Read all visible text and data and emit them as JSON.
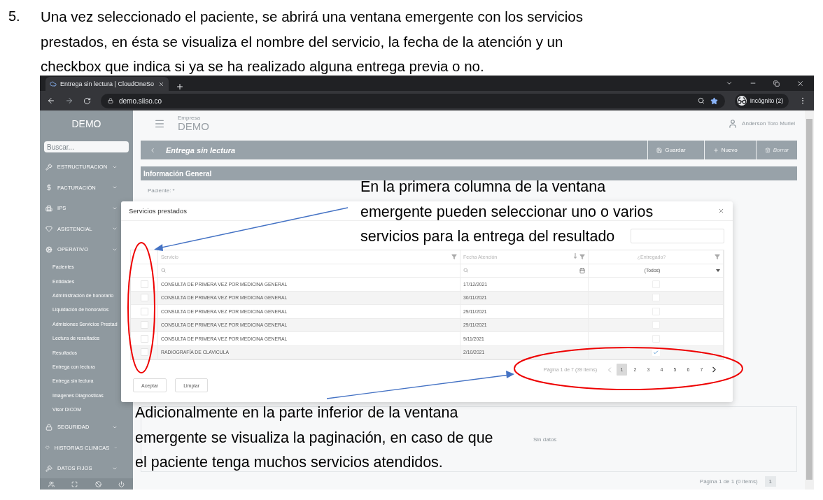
{
  "instruction": {
    "number": "5.",
    "text": "Una vez seleccionado el paciente, se abrirá una ventana emergente con los servicios\nprestados, en ésta se visualiza el nombre del servicio, la fecha de la atención y un\ncheckbox que indica si ya se ha realizado alguna entrega previa o no."
  },
  "browser": {
    "tab_title": "Entrega sin lectura | CloudOneSo",
    "url": "demo.siiso.co",
    "profile": "Incógnito (2)"
  },
  "sidebar": {
    "logo": "DEMO",
    "search_placeholder": "Buscar...",
    "sections": [
      {
        "label": "ESTRUCTURACION"
      },
      {
        "label": "FACTURACIÓN"
      },
      {
        "label": "IPS"
      },
      {
        "label": "ASISTENCIAL"
      },
      {
        "label": "OPERATIVO",
        "children": [
          {
            "label": "Pacientes"
          },
          {
            "label": "Entidades"
          },
          {
            "label": "Administración de honorario"
          },
          {
            "label": "Liquidación de honorarios"
          },
          {
            "label": "Admisiones Servicios Prestad"
          },
          {
            "label": "Lectura de resultados"
          },
          {
            "label": "Resultados"
          },
          {
            "label": "Entrega con lectura"
          },
          {
            "label": "Entrega sin lectura"
          },
          {
            "label": "Imagenes Diagnosticas"
          },
          {
            "label": "Visor DICOM"
          }
        ]
      },
      {
        "label": "SEGURIDAD"
      },
      {
        "label": "HISTORIAS CLINICAS"
      },
      {
        "label": "DATOS FIJOS"
      }
    ]
  },
  "header": {
    "company_label": "Empresa",
    "company": "DEMO",
    "user": "Anderson Toro Muriel"
  },
  "page_title": "Entrega sin lectura",
  "actions": [
    {
      "label": "Guardar",
      "disabled": false
    },
    {
      "label": "Nuevo",
      "disabled": false
    },
    {
      "label": "Borrar",
      "disabled": true
    }
  ],
  "section_title": "Información General",
  "field_label": "Paciente: *",
  "lower_grid": {
    "empty_text": "Sin datos",
    "pager": "Página 1 de 1 (0 items)",
    "page": "1"
  },
  "dialog": {
    "title": "Servicios prestados",
    "columns": [
      "Servicio",
      "Fecha Atención",
      "¿Entregado?"
    ],
    "filter_value": "(Todos)",
    "rows": [
      {
        "selected": false,
        "service": "CONSULTA DE PRIMERA VEZ POR MEDICINA GENERAL",
        "date": "17/12/2021",
        "delivered": false
      },
      {
        "selected": false,
        "service": "CONSULTA DE PRIMERA VEZ POR MEDICINA GENERAL",
        "date": "30/11/2021",
        "delivered": false
      },
      {
        "selected": false,
        "service": "CONSULTA DE PRIMERA VEZ POR MEDICINA GENERAL",
        "date": "29/11/2021",
        "delivered": false
      },
      {
        "selected": false,
        "service": "CONSULTA DE PRIMERA VEZ POR MEDICINA GENERAL",
        "date": "29/11/2021",
        "delivered": false
      },
      {
        "selected": false,
        "service": "CONSULTA DE PRIMERA VEZ POR MEDICINA GENERAL",
        "date": "9/11/2021",
        "delivered": false
      },
      {
        "selected": false,
        "service": "RADIOGRAFÍA DE CLAVICULA",
        "date": "2/10/2021",
        "delivered": true
      }
    ],
    "pager": {
      "summary": "Página 1 de 7 (39 items)",
      "pages": [
        {
          "label": "1",
          "selected": true
        },
        {
          "label": "2",
          "selected": false
        },
        {
          "label": "3",
          "selected": false
        },
        {
          "label": "4",
          "selected": false
        },
        {
          "label": "5",
          "selected": false
        },
        {
          "label": "6",
          "selected": false
        },
        {
          "label": "7",
          "selected": false
        }
      ]
    },
    "buttons": [
      "Aceptar",
      "Limpiar"
    ]
  },
  "annotations": [
    {
      "text": "En la primera columna de la ventana\nemergente pueden seleccionar uno o varios\nservicios para la entrega del resultado"
    },
    {
      "text": "Adicionalmente en la parte inferior de la ventana\nemergente se visualiza la paginación, en caso de que\nel paciente tenga muchos servicios atendidos."
    }
  ]
}
